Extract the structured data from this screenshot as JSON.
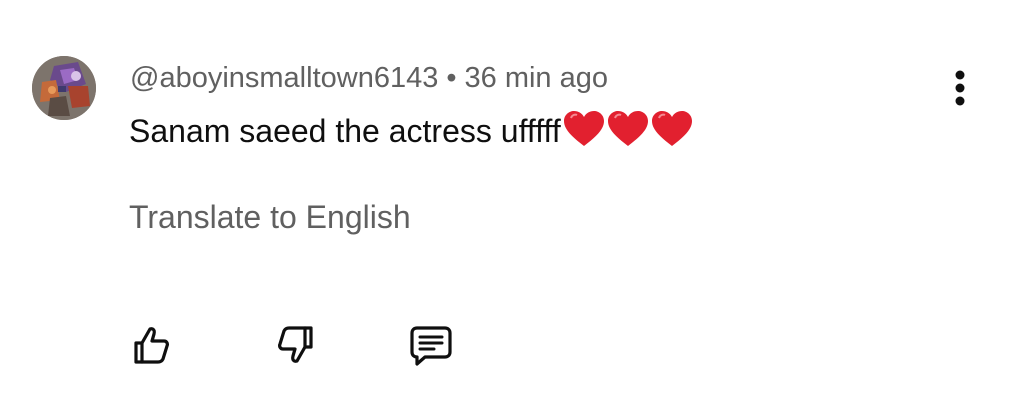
{
  "comment": {
    "author": "@aboyinsmalltown6143",
    "separator": "•",
    "time": "36 min ago",
    "text": "Sanam saeed the actress ufffff",
    "emoji_icons": [
      "red-heart-icon",
      "red-heart-icon",
      "red-heart-icon"
    ],
    "translate_label": "Translate to English"
  },
  "icons": {
    "menu": "more-vertical-icon",
    "like": "thumbs-up-icon",
    "dislike": "thumbs-down-icon",
    "reply": "comment-reply-icon"
  },
  "colors": {
    "primary_text": "#0f0f0f",
    "secondary_text": "#606060",
    "heart": "#e2202f"
  }
}
